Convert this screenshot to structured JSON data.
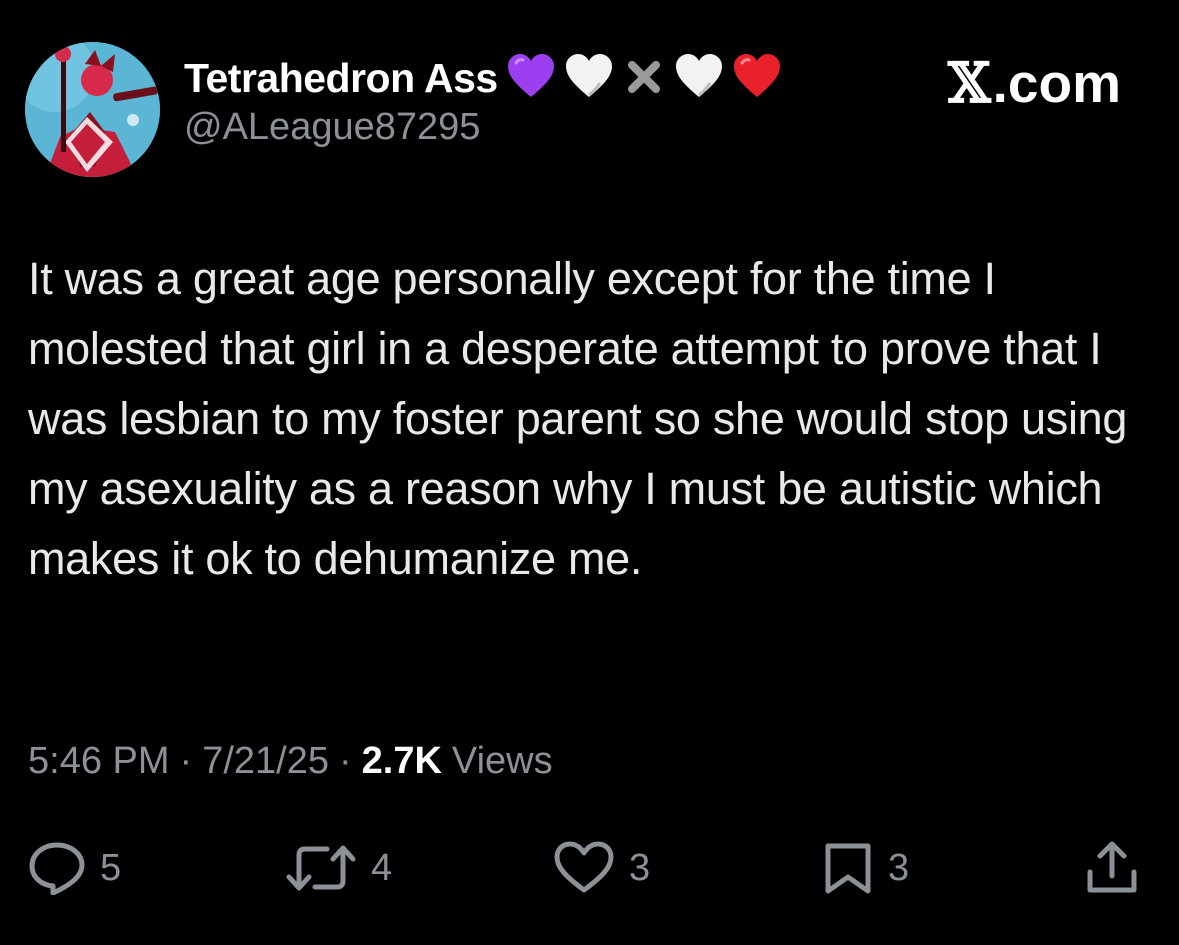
{
  "user": {
    "display_name": "Tetrahedron Ass",
    "name_emojis": [
      "purple-heart-icon",
      "white-heart-icon",
      "cross-mark-icon",
      "white-heart-icon",
      "red-heart-icon"
    ],
    "handle": "@ALeague87295",
    "avatar": "avatar-character-illustration"
  },
  "brand": {
    "x_glyph": "𝕏",
    "domain": ".com"
  },
  "tweet": {
    "text": "It was a great age personally except for the time I molested that girl in a desperate attempt to prove that I was lesbian to my foster parent so she would stop using my asexuality as a reason why I must be autistic which makes it ok to dehumanize me."
  },
  "meta": {
    "time": "5:46 PM",
    "date": "7/21/25",
    "views_count": "2.7K",
    "views_label": "Views",
    "separator": "·"
  },
  "actions": {
    "reply": {
      "icon": "reply-icon",
      "count": "5"
    },
    "repost": {
      "icon": "repost-icon",
      "count": "4"
    },
    "like": {
      "icon": "heart-icon",
      "count": "3"
    },
    "bookmark": {
      "icon": "bookmark-icon",
      "count": "3"
    },
    "share": {
      "icon": "share-icon"
    }
  },
  "colors": {
    "background": "#000000",
    "text": "#e7e9ea",
    "secondary": "#8b9197",
    "purple_heart": "#9b3ff0",
    "red_heart": "#e8212b"
  }
}
